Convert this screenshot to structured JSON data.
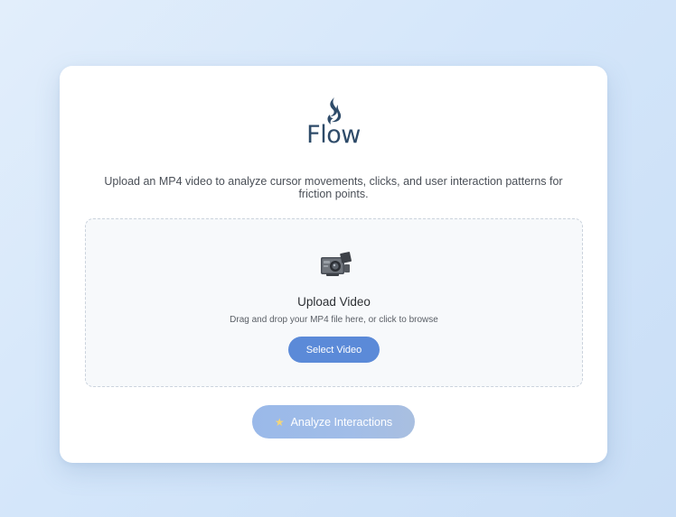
{
  "brand": {
    "name": "Flow",
    "icon": "flame-icon",
    "color": "#2e4b69"
  },
  "description": "Upload an MP4 video to analyze cursor movements, clicks, and user interaction patterns for friction points.",
  "dropzone": {
    "icon": "video-camera-icon",
    "title": "Upload Video",
    "hint": "Drag and drop your MP4 file here, or click to browse",
    "button_label": "Select Video"
  },
  "analyze_button": {
    "icon": "star-icon",
    "icon_glyph": "★",
    "label": "Analyze Interactions"
  },
  "colors": {
    "accent": "#5b8ad8",
    "analyze_disabled": "#a1bde8",
    "background": "#d4e6fa"
  }
}
